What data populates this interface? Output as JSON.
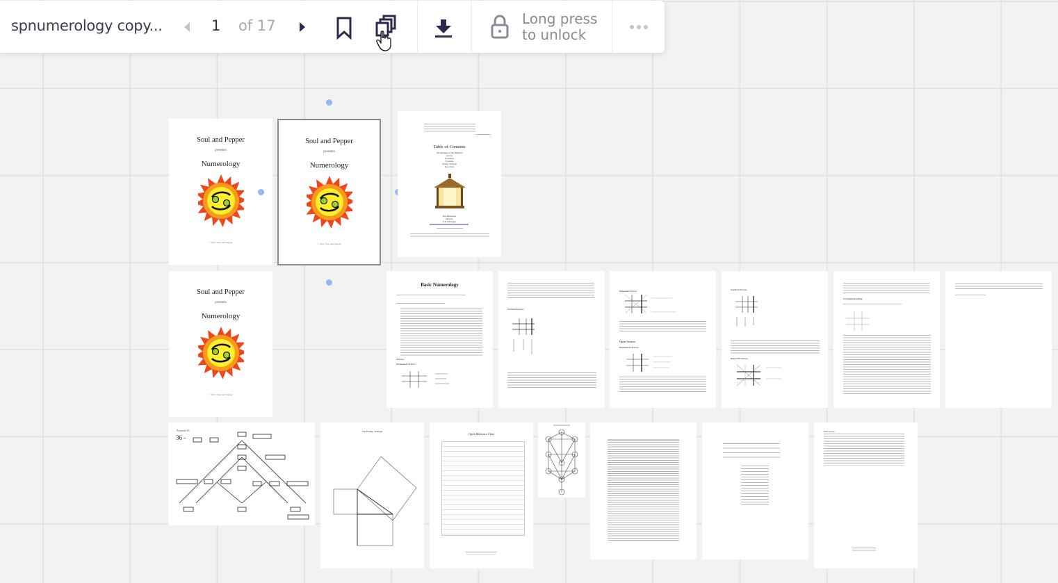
{
  "toolbar": {
    "document_title": "spnumerology copy...",
    "current_page": "1",
    "page_count_label": "of 17",
    "lock_label_line1": "Long press",
    "lock_label_line2": "to unlock",
    "icons": {
      "prev": "chevron-left-icon",
      "next": "chevron-right-icon",
      "bookmark": "bookmark-icon",
      "pages": "pages-stack-icon",
      "download": "download-icon",
      "lock": "lock-icon",
      "more": "more-horizontal-icon"
    },
    "colors": {
      "icon_active": "#2b2b4f",
      "icon_disabled": "#c4c4cc",
      "text_muted": "#a8a8b2"
    }
  },
  "canvas": {
    "selected_page": 2,
    "pages": [
      {
        "number": 1,
        "type": "cover",
        "brand": "Soul and Pepper",
        "presents": "presents",
        "title": "Numerology",
        "footer": "© 2011 Soul and Pepper"
      },
      {
        "number": 2,
        "type": "cover",
        "brand": "Soul and Pepper",
        "presents": "presents",
        "title": "Numerology",
        "footer": "© 2011 Soul and Pepper"
      },
      {
        "number": 3,
        "type": "toc",
        "heading": "Table of Contents",
        "items": [
          "The Meaning of the Numbers",
          "Arrows",
          "Worksheet",
          "Pyramids",
          "Pythag. Triangle",
          "Tarot Keys"
        ],
        "contact": [
          "Kira Henderson",
          "Director",
          "Soul and Pepper"
        ]
      },
      {
        "number": 4,
        "type": "cover",
        "brand": "Soul and Pepper",
        "presents": "presents",
        "title": "Numerology",
        "footer": "© 2011 Soul and Pepper"
      },
      {
        "number": 5,
        "type": "text",
        "heading": "Basic Numerology",
        "subheads": [
          "Arrows",
          "Horizontal Arrows"
        ]
      },
      {
        "number": 6,
        "type": "text",
        "subheads": [
          "Vertical Arrows"
        ]
      },
      {
        "number": 7,
        "type": "text",
        "subheads": [
          "Diagonal Arrows",
          "Open Arrows",
          "Horizontal Arrows"
        ]
      },
      {
        "number": 8,
        "type": "text",
        "subheads": [
          "Vertical Arrows",
          "Diagonal Arrows"
        ]
      },
      {
        "number": 9,
        "type": "text",
        "subheads": [
          "A Sample Reading"
        ]
      },
      {
        "number": 10,
        "type": "text",
        "subheads": []
      },
      {
        "number": 11,
        "type": "diagram",
        "heading": "Pyramid 36",
        "big_text": "36 -"
      },
      {
        "number": 12,
        "type": "diagram",
        "heading": "The Pythag. Triangle"
      },
      {
        "number": 13,
        "type": "table",
        "heading": "Quick Reference Chart"
      },
      {
        "number": 14,
        "type": "diagram",
        "heading": "Tree of Life"
      },
      {
        "number": 15,
        "type": "table"
      },
      {
        "number": 16,
        "type": "table"
      },
      {
        "number": 17,
        "type": "text",
        "heading": "Bibliography"
      }
    ]
  }
}
